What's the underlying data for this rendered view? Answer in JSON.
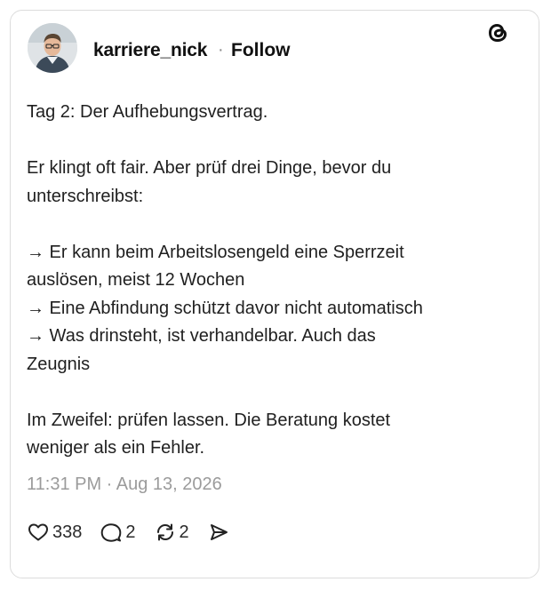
{
  "post": {
    "username": "karriere_nick",
    "separator": "·",
    "follow_label": "Follow",
    "paragraphs": [
      "Tag 2: Der Aufhebungsvertrag.",
      "Er klingt oft fair. Aber prüf drei Dinge, bevor du\nunterschreibst:",
      "→ Er kann beim Arbeitslosengeld eine Sperrzeit\nauslösen, meist 12 Wochen\n→ Eine Abfindung schützt davor nicht automatisch\n→ Was drinsteht, ist verhandelbar. Auch das\nZeugnis",
      "Im Zweifel: prüfen lassen. Die Beratung kostet\nweniger als ein Fehler."
    ],
    "timestamp": "11:31 PM · Aug 13, 2026"
  },
  "actions": {
    "likes": "338",
    "replies": "2",
    "reposts": "2"
  },
  "icons": {
    "logo": "threads-logo-icon",
    "like": "heart-icon",
    "reply": "comment-icon",
    "repost": "repost-icon",
    "share": "send-icon"
  }
}
